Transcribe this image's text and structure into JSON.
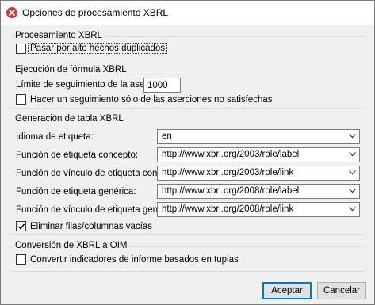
{
  "window": {
    "title": "Opciones de procesamiento XBRL"
  },
  "xbrl_processing": {
    "group_label": "Procesamiento XBRL",
    "ignore_duplicates_label": "Pasar por alto hechos duplicados",
    "ignore_duplicates_checked": false
  },
  "formula_execution": {
    "group_label": "Ejecución de fórmula XBRL",
    "assertion_limit_label": "Límite de seguimiento de la aserción:",
    "assertion_limit_value": "1000",
    "track_unsatisfied_label": "Hacer un seguimiento sólo de las aserciones no satisfechas",
    "track_unsatisfied_checked": false
  },
  "table_generation": {
    "group_label": "Generación de tabla XBRL",
    "rows": [
      {
        "label": "Idioma de etiqueta:",
        "value": "en"
      },
      {
        "label": "Función de etiqueta concepto:",
        "value": "http://www.xbrl.org/2003/role/label"
      },
      {
        "label": "Función de vínculo de etiqueta concepto:",
        "value": "http://www.xbrl.org/2003/role/link"
      },
      {
        "label": "Función de etiqueta genérica:",
        "value": "http://www.xbrl.org/2008/role/label"
      },
      {
        "label": "Función de vínculo de etiqueta genérica:",
        "value": "http://www.xbrl.org/2008/role/link"
      }
    ],
    "remove_empty_label": "Eliminar filas/columnas vacías",
    "remove_empty_checked": true
  },
  "oim_conversion": {
    "group_label": "Conversión de XBRL a OIM",
    "convert_tuples_label": "Convertir indicadores de informe basados en tuplas",
    "convert_tuples_checked": false
  },
  "buttons": {
    "accept": "Aceptar",
    "cancel": "Cancelar"
  },
  "colors": {
    "accent": "#0078d7",
    "app_icon": "#d8332b"
  },
  "icons": {
    "app": "xbrl-app-icon",
    "dropdown": "chevron-down-icon",
    "check": "checkmark-icon"
  }
}
